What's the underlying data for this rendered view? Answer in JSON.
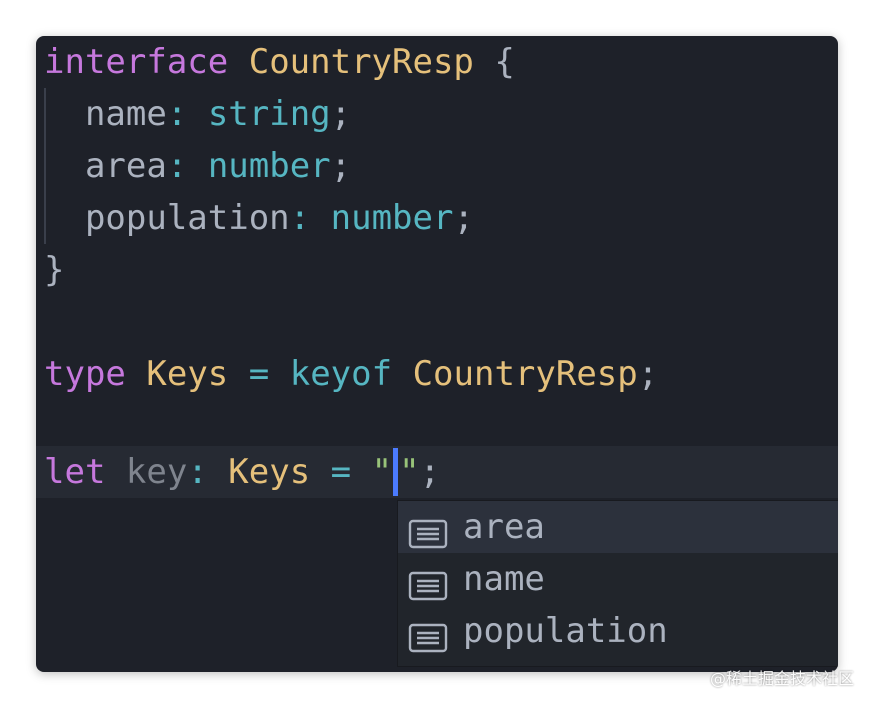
{
  "colors": {
    "background": "#1e2129",
    "keyword": "#c678dd",
    "type": "#e5c07b",
    "builtin": "#56b6c2",
    "string": "#98c379",
    "text": "#abb2bf",
    "cursor": "#4b7bff",
    "squiggle": "#e06c75"
  },
  "code": {
    "l1": {
      "kw": "interface",
      "name": "CountryResp",
      "brace": "{"
    },
    "l2": {
      "prop": "name",
      "colon": ":",
      "type": "string",
      "semi": ";"
    },
    "l3": {
      "prop": "area",
      "colon": ":",
      "type": "number",
      "semi": ";"
    },
    "l4": {
      "prop": "population",
      "colon": ":",
      "type": "number",
      "semi": ";"
    },
    "l5": {
      "brace": "}"
    },
    "l7": {
      "kw": "type",
      "name": "Keys",
      "eq": "=",
      "op": "keyof",
      "ref": "CountryResp",
      "semi": ";"
    },
    "l9": {
      "kw": "let",
      "var": "key",
      "colon": ":",
      "type": "Keys",
      "eq": "=",
      "quote_open": "\"",
      "quote_close": "\"",
      "semi": ";"
    }
  },
  "suggestions": [
    {
      "label": "area",
      "icon": "property-icon"
    },
    {
      "label": "name",
      "icon": "property-icon"
    },
    {
      "label": "population",
      "icon": "property-icon"
    }
  ],
  "watermark": "@稀土掘金技术社区"
}
